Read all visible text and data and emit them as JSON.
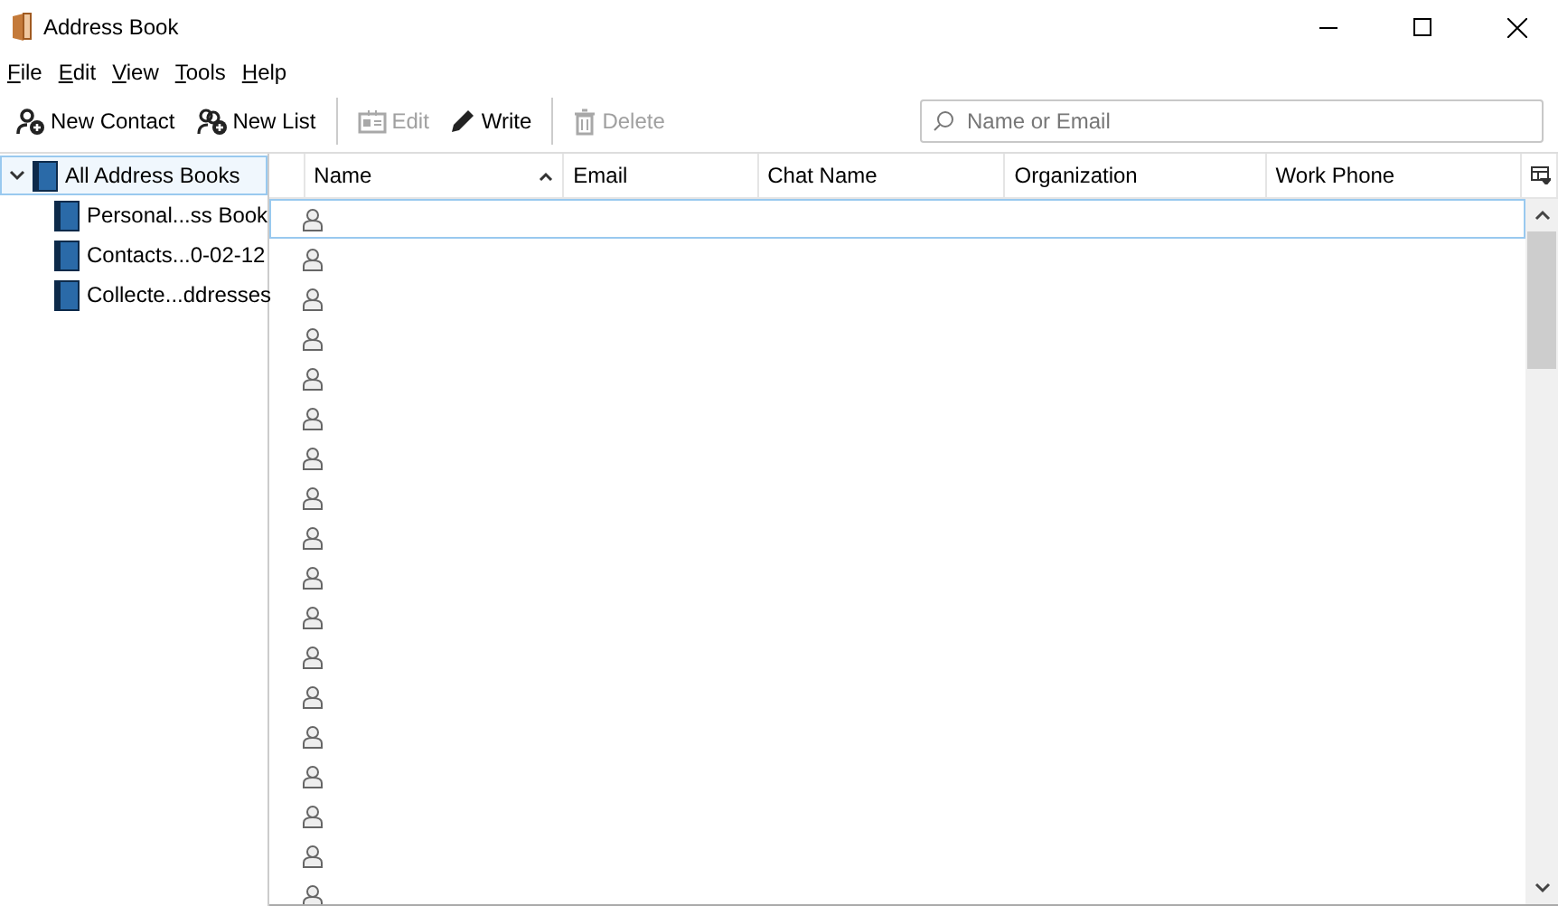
{
  "window": {
    "title": "Address Book"
  },
  "menu": [
    "File",
    "Edit",
    "View",
    "Tools",
    "Help"
  ],
  "toolbar": [
    {
      "kind": "button",
      "label": "New Contact",
      "disabled": false
    },
    {
      "kind": "button",
      "label": "New List",
      "disabled": false
    },
    {
      "kind": "separator"
    },
    {
      "kind": "button",
      "label": "Edit",
      "disabled": true
    },
    {
      "kind": "button",
      "label": "Write",
      "disabled": false
    },
    {
      "kind": "separator"
    },
    {
      "kind": "button",
      "label": "Delete",
      "disabled": true
    }
  ],
  "search": {
    "placeholder": "Name or Email"
  },
  "sidebar": {
    "items": [
      {
        "label": "All Address Books",
        "selected": true,
        "expanded": true,
        "children": [
          {
            "label": "Personal...ss Book",
            "selected": false
          },
          {
            "label": "Contacts...0-02-12",
            "selected": false
          },
          {
            "label": "Collecte...ddresses",
            "selected": false
          }
        ]
      }
    ]
  },
  "table": {
    "columns": [
      {
        "label": "Name",
        "sorted": true
      },
      {
        "label": "Email",
        "sorted": false
      },
      {
        "label": "Chat Name",
        "sorted": false
      },
      {
        "label": "Organization",
        "sorted": false
      },
      {
        "label": "Work Phone",
        "sorted": false
      }
    ],
    "rows": [
      {
        "selected": true
      },
      {
        "selected": false
      },
      {
        "selected": false
      },
      {
        "selected": false
      },
      {
        "selected": false
      },
      {
        "selected": false
      },
      {
        "selected": false
      },
      {
        "selected": false
      },
      {
        "selected": false
      },
      {
        "selected": false
      },
      {
        "selected": false
      },
      {
        "selected": false
      },
      {
        "selected": false
      },
      {
        "selected": false
      },
      {
        "selected": false
      },
      {
        "selected": false
      },
      {
        "selected": false
      },
      {
        "selected": false
      }
    ]
  }
}
